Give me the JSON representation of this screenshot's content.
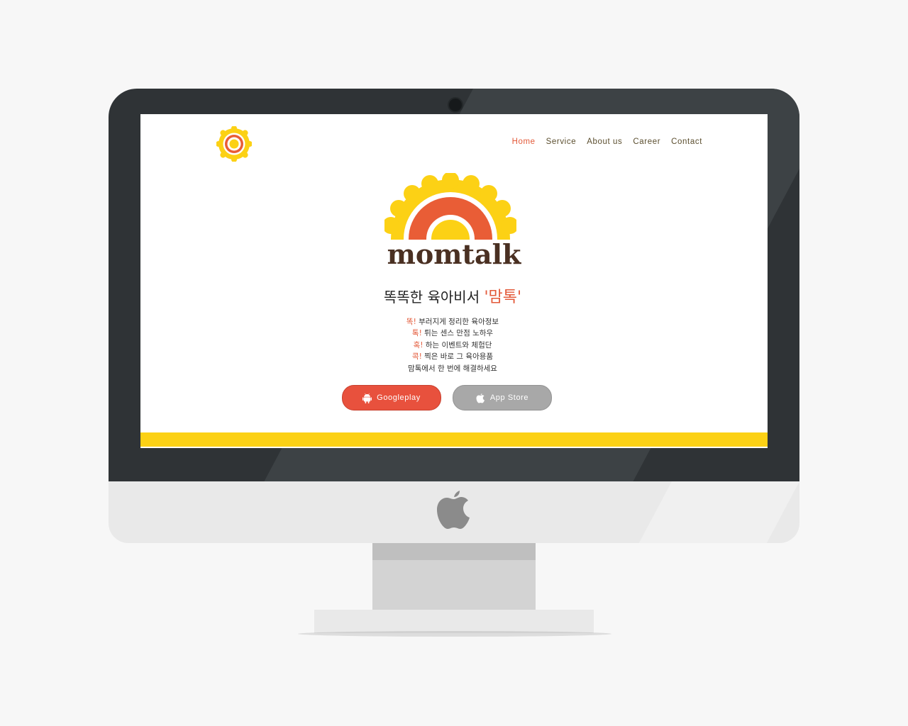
{
  "nav": {
    "items": [
      {
        "label": "Home",
        "active": true
      },
      {
        "label": "Service",
        "active": false
      },
      {
        "label": "About us",
        "active": false
      },
      {
        "label": "Career",
        "active": false
      },
      {
        "label": "Contact",
        "active": false
      }
    ]
  },
  "hero": {
    "wordmark": "momtalk",
    "tagline_prefix": "똑똑한 육아비서 ",
    "tagline_accent": "'맘톡'",
    "features": [
      {
        "keyword": "똑!",
        "text": " 부러지게 정리한 육아정보"
      },
      {
        "keyword": "톡!",
        "text": " 튀는 센스 만점 노하우"
      },
      {
        "keyword": "혹!",
        "text": " 하는 이벤트와 체험단"
      },
      {
        "keyword": "콕!",
        "text": " 찍은 바로 그 육아용품"
      }
    ],
    "closing": "맘톡에서 한 번에 해결하세요"
  },
  "buttons": {
    "googleplay_label": "Googleplay",
    "appstore_label": "App Store"
  },
  "icons": {
    "site_logo": "sun-logo-icon",
    "hero_logo": "sun-logo-icon",
    "googleplay": "android-icon",
    "appstore": "apple-icon",
    "device_logo": "apple-icon"
  },
  "colors": {
    "accent": "#e35a3a",
    "sun_yellow": "#fcd115",
    "sun_orange": "#e95d36",
    "wordmark_brown": "#4a3022",
    "googleplay_button": "#e8513d",
    "appstore_button": "#a8a8a8",
    "bezel": "#2f3336"
  }
}
